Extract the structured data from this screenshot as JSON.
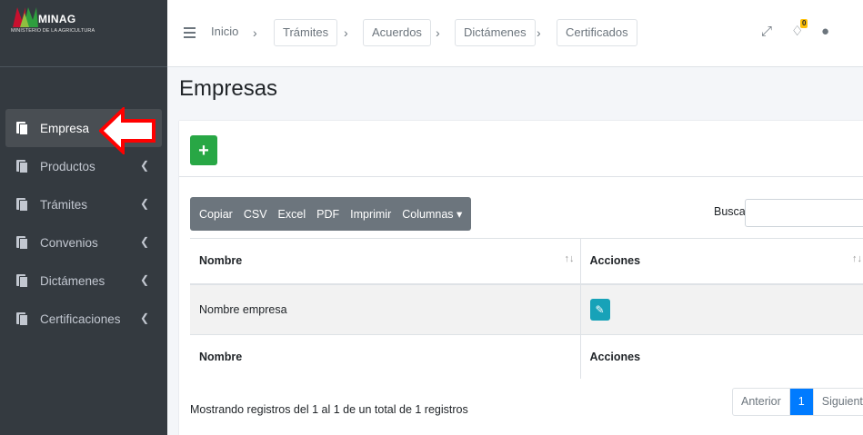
{
  "brand": {
    "name": "MINAG",
    "subtitle": "MINISTERIO DE LA AGRICULTURA",
    "colors": {
      "red": "#c8102e",
      "green": "#2e9e3e"
    }
  },
  "sidebar": {
    "items": [
      {
        "label": "Empresa",
        "icon": "file-copy-icon",
        "active": true
      },
      {
        "label": "Productos",
        "icon": "file-copy-icon"
      },
      {
        "label": "Trámites",
        "icon": "file-copy-icon"
      },
      {
        "label": "Convenios",
        "icon": "file-copy-icon"
      },
      {
        "label": "Dictámenes",
        "icon": "file-copy-icon"
      },
      {
        "label": "Certificaciones",
        "icon": "file-copy-icon"
      }
    ]
  },
  "breadcrumb": {
    "home": "Inicio",
    "items": [
      "Trámites",
      "Acuerdos",
      "Dictámenes",
      "Certificados"
    ]
  },
  "topbar": {
    "notifications_count": "0"
  },
  "page": {
    "title": "Empresas"
  },
  "toolbar": {
    "add_label": "+",
    "buttons": [
      "Copiar",
      "CSV",
      "Excel",
      "PDF",
      "Imprimir",
      "Columnas ▾"
    ],
    "search_label": "Buscar:",
    "search_value": ""
  },
  "table": {
    "columns": [
      "Nombre",
      "Acciones"
    ],
    "rows": [
      {
        "nombre": "Nombre empresa"
      }
    ],
    "footer": [
      "Nombre",
      "Acciones"
    ]
  },
  "footer": {
    "info": "Mostrando registros del 1 al 1 de un total de 1 registros",
    "prev": "Anterior",
    "page": "1",
    "next": "Siguiente"
  },
  "colors": {
    "accent": "#007bff",
    "success": "#28a745",
    "info": "#17a2b8",
    "sidebar": "#343a40",
    "annotation": "#ff0000"
  }
}
